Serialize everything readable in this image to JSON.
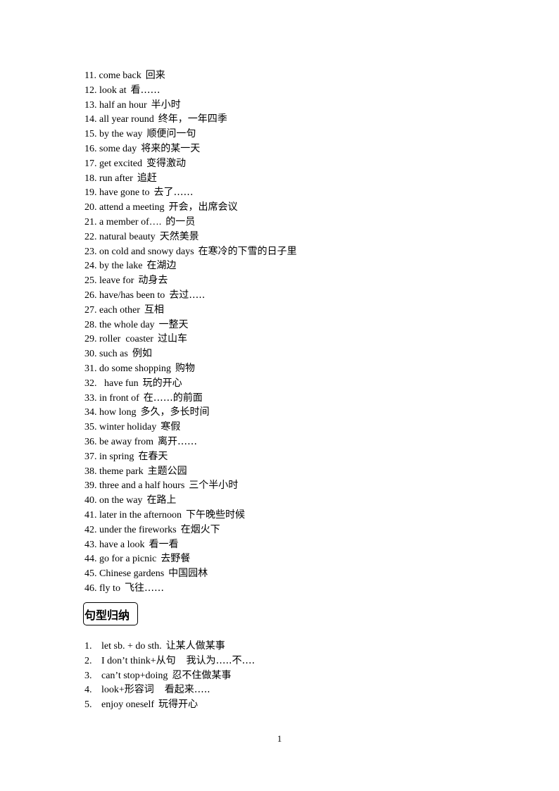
{
  "vocabulary": [
    {
      "num": "11.",
      "en": "come back",
      "zh": "回来"
    },
    {
      "num": "12.",
      "en": "look at",
      "zh": "看……"
    },
    {
      "num": "13.",
      "en": "half an hour",
      "zh": "半小时"
    },
    {
      "num": "14.",
      "en": "all year round",
      "zh": "终年，一年四季"
    },
    {
      "num": "15.",
      "en": "by the way",
      "zh": "顺便问一句"
    },
    {
      "num": "16.",
      "en": "some day",
      "zh": "将来的某一天"
    },
    {
      "num": "17.",
      "en": "get excited",
      "zh": "变得激动"
    },
    {
      "num": "18.",
      "en": "run after",
      "zh": "追赶"
    },
    {
      "num": "19.",
      "en": "have gone to",
      "zh": "去了……"
    },
    {
      "num": "20.",
      "en": "attend a meeting",
      "zh": "开会，出席会议"
    },
    {
      "num": "21.",
      "en": "a member of….",
      "zh": "的一员"
    },
    {
      "num": "22.",
      "en": "natural beauty",
      "zh": "天然美景"
    },
    {
      "num": "23.",
      "en": "on cold and snowy days",
      "zh": "在寒冷的下雪的日子里"
    },
    {
      "num": "24.",
      "en": "by the lake",
      "zh": "在湖边"
    },
    {
      "num": "25.",
      "en": "leave for",
      "zh": "动身去"
    },
    {
      "num": "26.",
      "en": "have/has been to",
      "zh": "去过….."
    },
    {
      "num": "27.",
      "en": "each other",
      "zh": "互相"
    },
    {
      "num": "28.",
      "en": "the whole day",
      "zh": "一整天"
    },
    {
      "num": "29.",
      "en": "roller  coaster",
      "zh": "过山车"
    },
    {
      "num": "30.",
      "en": "such as",
      "zh": "例如"
    },
    {
      "num": "31.",
      "en": "do some shopping",
      "zh": "购物"
    },
    {
      "num": "32.",
      "en": "  have fun",
      "zh": "玩的开心"
    },
    {
      "num": "33.",
      "en": "in front of",
      "zh": "在……的前面"
    },
    {
      "num": "34.",
      "en": "how long",
      "zh": "多久，多长时间"
    },
    {
      "num": "35.",
      "en": "winter holiday",
      "zh": "寒假"
    },
    {
      "num": "36.",
      "en": "be away from",
      "zh": "离开……"
    },
    {
      "num": "37.",
      "en": "in spring",
      "zh": "在春天"
    },
    {
      "num": "38.",
      "en": "theme park",
      "zh": "主题公园"
    },
    {
      "num": "39.",
      "en": "three and a half hours",
      "zh": "三个半小时"
    },
    {
      "num": "40.",
      "en": "on the way",
      "zh": "在路上"
    },
    {
      "num": "41.",
      "en": "later in the afternoon",
      "zh": "下午晚些时候"
    },
    {
      "num": "42.",
      "en": "under the fireworks",
      "zh": "在烟火下"
    },
    {
      "num": "43.",
      "en": "have a look",
      "zh": "看一看"
    },
    {
      "num": "44.",
      "en": "go for a picnic",
      "zh": "去野餐"
    },
    {
      "num": "45.",
      "en": "Chinese gardens",
      "zh": "中国园林"
    },
    {
      "num": "46.",
      "en": "fly to",
      "zh": "飞往……"
    }
  ],
  "section_heading": "句型归纳",
  "patterns": [
    {
      "num": "1.",
      "en": "let sb. + do sth.",
      "zh": "让某人做某事"
    },
    {
      "num": "2.",
      "en": "I don’t think+从句",
      "zh": "  我认为…..不…."
    },
    {
      "num": "3.",
      "en": "can’t stop+doing",
      "zh": "忍不住做某事"
    },
    {
      "num": "4.",
      "en": "look+形容词",
      "zh": "  看起来….."
    },
    {
      "num": "5.",
      "en": "enjoy oneself",
      "zh": "玩得开心"
    }
  ],
  "page_number": "1"
}
